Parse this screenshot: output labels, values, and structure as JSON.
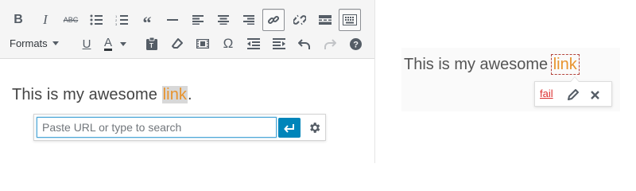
{
  "editor": {
    "formats_label": "Formats",
    "toolbar_icons": [
      "bold-icon",
      "italic-icon",
      "strikethrough-icon",
      "bulleted-list-icon",
      "numbered-list-icon",
      "blockquote-icon",
      "horizontal-line-icon",
      "align-left-icon",
      "align-center-icon",
      "align-right-icon",
      "insert-link-icon",
      "remove-link-icon",
      "read-more-icon",
      "toolbar-toggle-icon",
      "underline-icon",
      "text-color-icon",
      "paste-as-text-icon",
      "clear-formatting-icon",
      "insert-media-icon",
      "special-character-icon",
      "decrease-indent-icon",
      "increase-indent-icon",
      "undo-icon",
      "redo-icon",
      "help-icon"
    ],
    "content_prefix": "This is my awesome ",
    "link_text": "link",
    "content_suffix": ".",
    "link_input": {
      "value": "",
      "placeholder": "Paste URL or type to search"
    }
  },
  "preview": {
    "content_prefix": "This is my awesome ",
    "link_text": "link",
    "link_toolbar": {
      "url_label": "fail"
    }
  },
  "colors": {
    "link": "#e8932d",
    "apply_button": "#0085ba",
    "error_link": "#dc3232",
    "toolbar_bg": "#f5f5f5"
  }
}
